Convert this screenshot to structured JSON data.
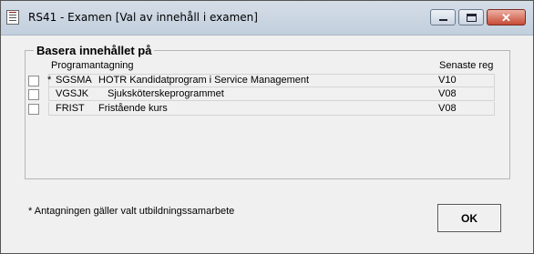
{
  "window": {
    "title": "RS41 - Examen [Val av innehåll i examen]",
    "buttons": [
      "minimize",
      "maximize",
      "close"
    ]
  },
  "group": {
    "title": "Basera innehållet på",
    "columns": {
      "programantagning": "Programantagning",
      "senaste_reg": "Senaste reg"
    },
    "rows": [
      {
        "checked": false,
        "star": "*",
        "code": "SGSMA",
        "name": "HOTR   Kandidatprogram i Service Management",
        "reg": "V10"
      },
      {
        "checked": false,
        "star": "",
        "code": "VGSJK",
        "name": "Sjuksköterskeprogrammet",
        "reg": "V08"
      },
      {
        "checked": false,
        "star": "",
        "code": "FRIST",
        "name": "Fristående kurs",
        "reg": "V08"
      }
    ]
  },
  "footnote": "* Antagningen gäller valt utbildningssamarbete",
  "ok_label": "OK"
}
